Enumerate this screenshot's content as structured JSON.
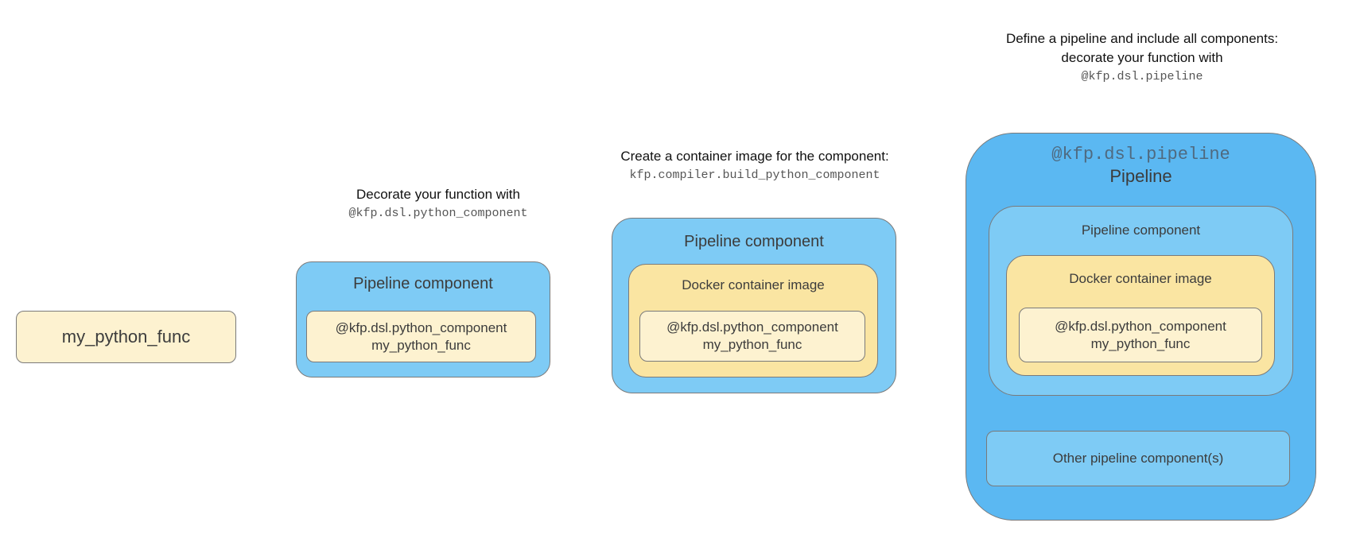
{
  "step1": {
    "function_label": "my_python_func"
  },
  "step2": {
    "caption": "Decorate your function with",
    "caption_code": "@kfp.dsl.python_component",
    "component_title": "Pipeline component",
    "inner_decorator": "@kfp.dsl.python_component",
    "inner_function": "my_python_func"
  },
  "step3": {
    "caption": "Create a container image for the component:",
    "caption_code": "kfp.compiler.build_python_component",
    "component_title": "Pipeline component",
    "docker_title": "Docker container image",
    "inner_decorator": "@kfp.dsl.python_component",
    "inner_function": "my_python_func"
  },
  "step4": {
    "caption_line1": "Define a pipeline and include all components:",
    "caption_line2": "decorate your function with",
    "caption_code": "@kfp.dsl.pipeline",
    "pipeline_decorator": "@kfp.dsl.pipeline",
    "pipeline_title": "Pipeline",
    "component_title": "Pipeline component",
    "docker_title": "Docker container image",
    "inner_decorator": "@kfp.dsl.python_component",
    "inner_function": "my_python_func",
    "other_components": "Other pipeline component(s)"
  },
  "colors": {
    "pipeline": "#5bb8f2",
    "component": "#7ecbf5",
    "docker": "#fae5a2",
    "function": "#fdf2d0",
    "border": "#7a7a7a"
  }
}
